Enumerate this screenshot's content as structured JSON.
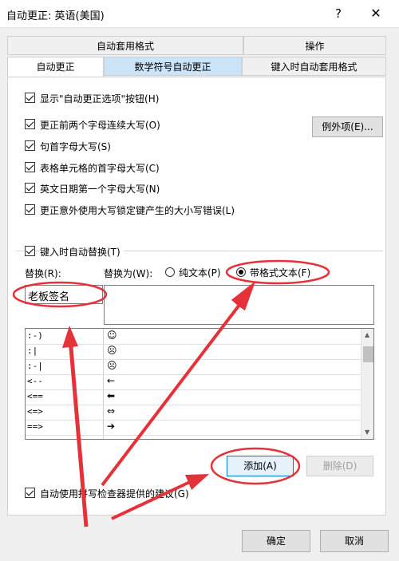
{
  "window": {
    "title": "自动更正: 英语(美国)",
    "help_label": "?",
    "close_label": "✕"
  },
  "tabs_row1": [
    {
      "label": "自动套用格式"
    },
    {
      "label": "操作"
    }
  ],
  "tabs_row2": [
    {
      "label": "自动更正"
    },
    {
      "label": "数学符号自动更正"
    },
    {
      "label": "键入时自动套用格式"
    }
  ],
  "options": {
    "show_buttons": "显示\"自动更正选项\"按钮(H)",
    "two_caps": "更正前两个字母连续大写(O)",
    "first_letter_sentence": "句首字母大写(S)",
    "first_letter_table": "表格单元格的首字母大写(C)",
    "day_names": "英文日期第一个字母大写(N)",
    "caps_lock": "更正意外使用大写锁定键产生的大小写错误(L)",
    "exceptions_button": "例外项(E)..."
  },
  "replace_group": {
    "title": "键入时自动替换(T)",
    "replace_label": "替换(R):",
    "with_label": "替换为(W):",
    "plain_text": "纯文本(P)",
    "formatted_text": "带格式文本(F)",
    "replace_value": "老板签名",
    "with_value": ""
  },
  "entries": [
    {
      "key": ":-)",
      "value": "☺"
    },
    {
      "key": ":|",
      "value": "☹"
    },
    {
      "key": ":-|",
      "value": "☹"
    },
    {
      "key": "<--",
      "value": "←"
    },
    {
      "key": "<==",
      "value": "⬅"
    },
    {
      "key": "<=>",
      "value": "⇔"
    },
    {
      "key": "==>",
      "value": "➔"
    }
  ],
  "actions": {
    "add": "添加(A)",
    "delete": "删除(D)"
  },
  "spell_option": "自动使用拼写检查器提供的建议(G)",
  "footer": {
    "ok": "确定",
    "cancel": "取消"
  },
  "colors": {
    "accent_tab": "#cce4f7",
    "annotation": "#e5323a"
  }
}
